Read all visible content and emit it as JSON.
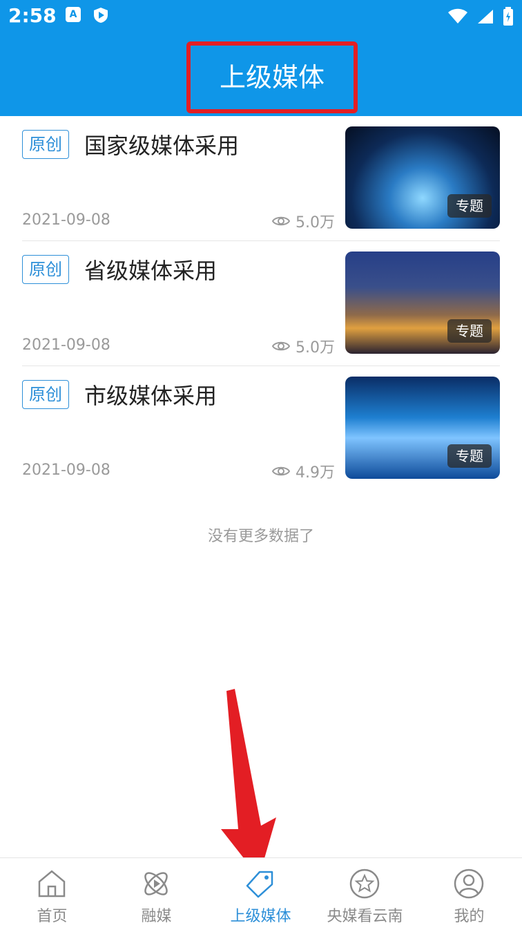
{
  "status_bar": {
    "time": "2:58",
    "left_icons": [
      "a-icon",
      "shield-play-icon"
    ],
    "right_icons": [
      "wifi-icon",
      "signal-icon",
      "battery-icon"
    ]
  },
  "header": {
    "title": "上级媒体"
  },
  "items": [
    {
      "tag": "原创",
      "title": "国家级媒体采用",
      "date": "2021-09-08",
      "views": "5.0万",
      "badge": "专题"
    },
    {
      "tag": "原创",
      "title": "省级媒体采用",
      "date": "2021-09-08",
      "views": "5.0万",
      "badge": "专题"
    },
    {
      "tag": "原创",
      "title": "市级媒体采用",
      "date": "2021-09-08",
      "views": "4.9万",
      "badge": "专题"
    }
  ],
  "list_end_text": "没有更多数据了",
  "tabs": [
    {
      "label": "首页",
      "icon": "home-icon"
    },
    {
      "label": "融媒",
      "icon": "atom-play-icon"
    },
    {
      "label": "上级媒体",
      "icon": "tag-icon",
      "active": true
    },
    {
      "label": "央媒看云南",
      "icon": "star-circle-icon"
    },
    {
      "label": "我的",
      "icon": "user-circle-icon"
    }
  ],
  "colors": {
    "primary": "#0f96e8",
    "accent": "#2d8fd8",
    "highlight": "#e31e24"
  }
}
